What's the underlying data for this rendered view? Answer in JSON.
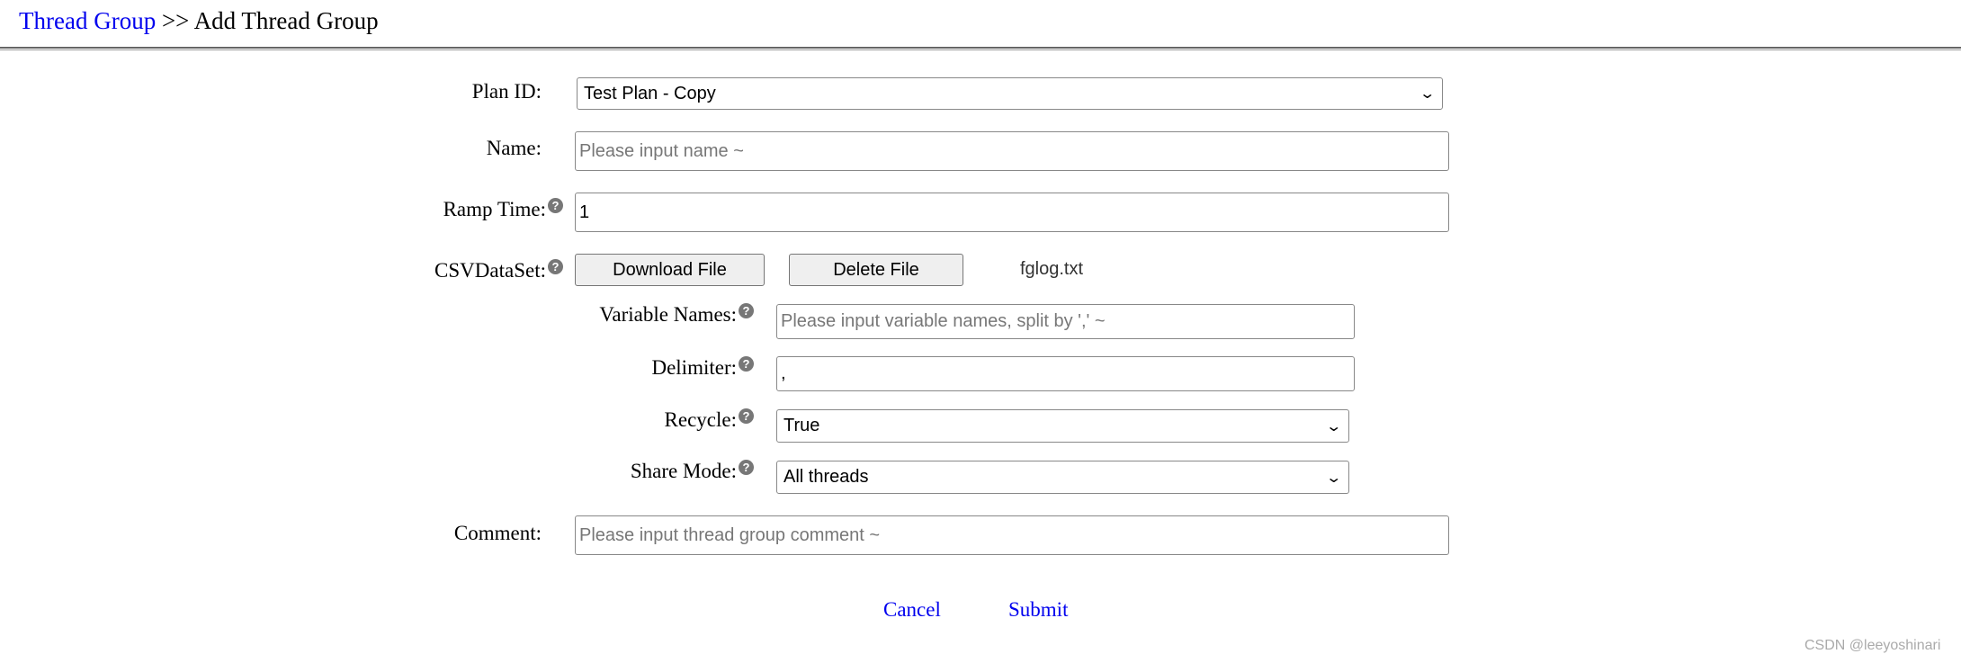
{
  "breadcrumb": {
    "parent": "Thread Group",
    "separator": " >> ",
    "current": "Add Thread Group"
  },
  "form": {
    "plan_id": {
      "label": "Plan ID:",
      "value": "Test Plan - Copy"
    },
    "name": {
      "label": "Name:",
      "placeholder": "Please input name ~"
    },
    "ramp_time": {
      "label": "Ramp Time:",
      "value": "1"
    },
    "csv": {
      "label": "CSVDataSet:",
      "download_label": "Download File",
      "delete_label": "Delete File",
      "file_name": "fglog.txt",
      "variable_names": {
        "label": "Variable Names:",
        "placeholder": "Please input variable names, split by ',' ~"
      },
      "delimiter": {
        "label": "Delimiter:",
        "value": ","
      },
      "recycle": {
        "label": "Recycle:",
        "value": "True"
      },
      "share_mode": {
        "label": "Share Mode:",
        "value": "All threads"
      }
    },
    "comment": {
      "label": "Comment:",
      "placeholder": "Please input thread group comment ~"
    },
    "help_glyph": "?"
  },
  "actions": {
    "cancel": "Cancel",
    "submit": "Submit"
  },
  "watermark": "CSDN @leeyoshinari"
}
